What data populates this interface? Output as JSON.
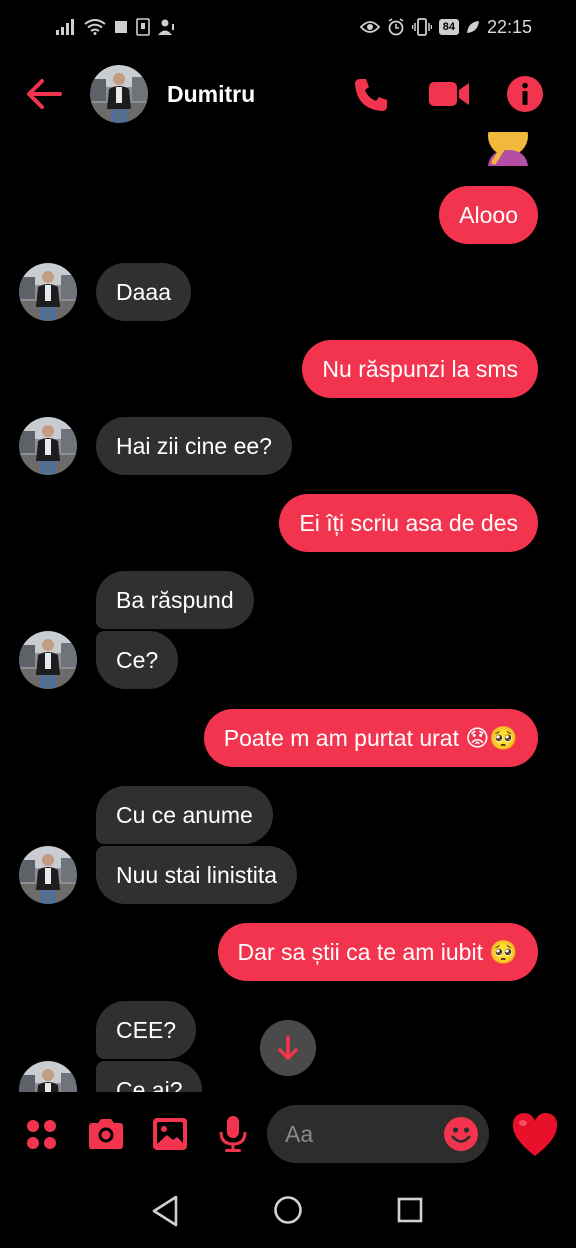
{
  "status_bar": {
    "battery": "84",
    "time": "22:15"
  },
  "header": {
    "contact_name": "Dumitru"
  },
  "messages": [
    {
      "dir": "out",
      "text": "Alooo"
    },
    {
      "dir": "in",
      "text": "Daaa"
    },
    {
      "dir": "out",
      "text": "Nu răspunzi la sms"
    },
    {
      "dir": "in",
      "text": "Hai zii cine ee?"
    },
    {
      "dir": "out",
      "text": "Ei îți scriu asa de des"
    },
    {
      "dir": "in",
      "text": "Ba răspund"
    },
    {
      "dir": "in",
      "text": "Ce?"
    },
    {
      "dir": "out",
      "text": "Poate m am purtat urat 😟🥺"
    },
    {
      "dir": "in",
      "text": "Cu ce anume"
    },
    {
      "dir": "in",
      "text": "Nuu stai linistita"
    },
    {
      "dir": "out",
      "text": "Dar sa știi ca te am iubit 🥺"
    },
    {
      "dir": "in",
      "text": "CEE?"
    },
    {
      "dir": "in",
      "text": "Ce ai?"
    }
  ],
  "composer": {
    "placeholder": "Aa",
    "reaction": "❤️"
  },
  "colors": {
    "accent": "#f3344f",
    "incoming_bubble": "#303030",
    "background": "#000000"
  }
}
